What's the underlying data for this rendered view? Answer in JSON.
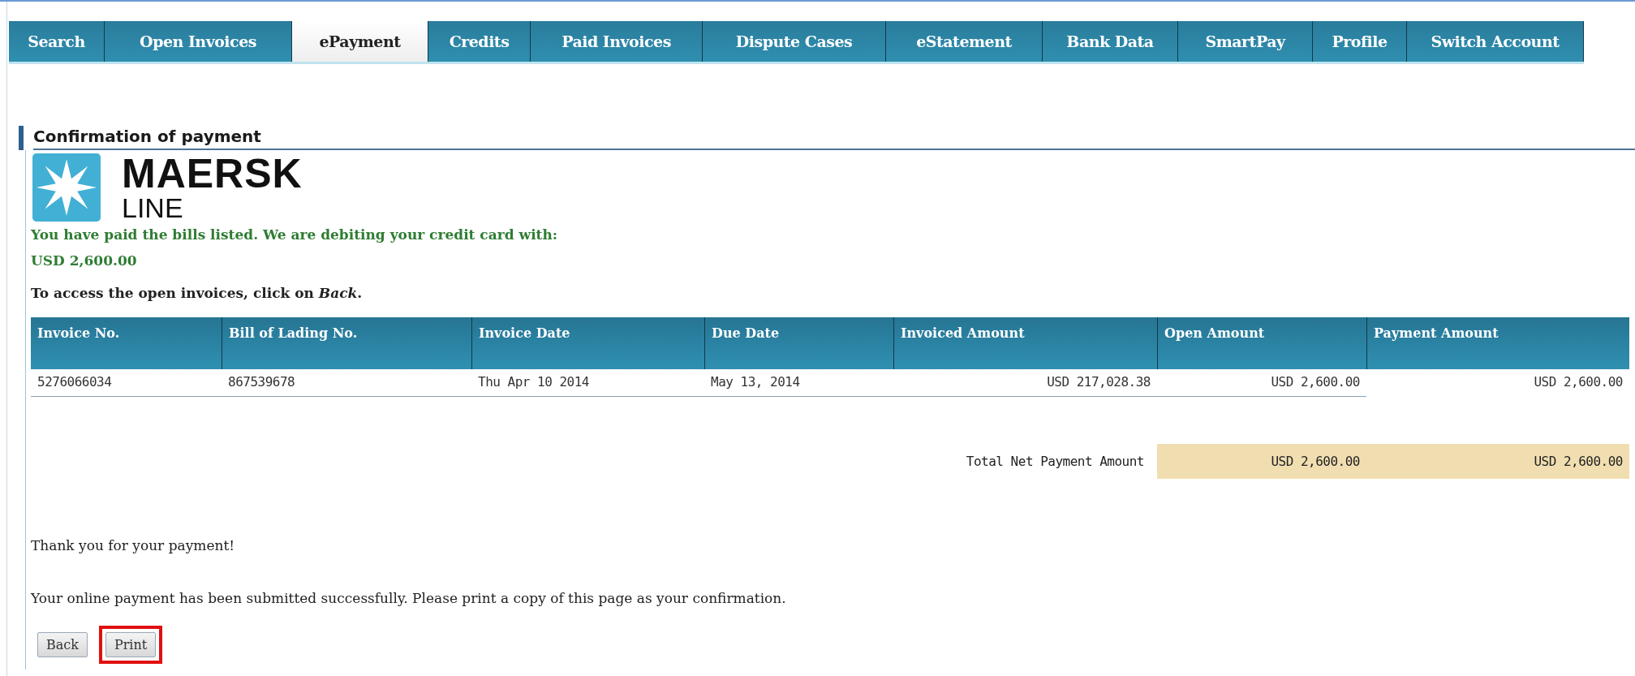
{
  "tabs": [
    {
      "label": "Search",
      "selected": false
    },
    {
      "label": "Open Invoices",
      "selected": false
    },
    {
      "label": "ePayment",
      "selected": true
    },
    {
      "label": "Credits",
      "selected": false
    },
    {
      "label": "Paid Invoices",
      "selected": false
    },
    {
      "label": "Dispute Cases",
      "selected": false
    },
    {
      "label": "eStatement",
      "selected": false
    },
    {
      "label": "Bank Data",
      "selected": false
    },
    {
      "label": "SmartPay",
      "selected": false
    },
    {
      "label": "Profile",
      "selected": false
    },
    {
      "label": "Switch Account",
      "selected": false
    }
  ],
  "section_title": "Confirmation of payment",
  "logo": {
    "name": "MAERSK",
    "subtitle": "LINE"
  },
  "success_message": "You have paid the bills listed. We are debiting your credit card with:",
  "debit_amount": "USD 2,600.00",
  "instruction": "To access the open invoices, click on *Back*.",
  "table": {
    "columns": [
      "Invoice No.",
      "Bill of Lading No.",
      "Invoice Date",
      "Due Date",
      "Invoiced Amount",
      "Open Amount",
      "Payment Amount"
    ],
    "rows": [
      [
        "5276066034",
        "867539678",
        "Thu Apr 10 2014",
        "May 13, 2014",
        "USD 217,028.38",
        "USD 2,600.00",
        "USD 2,600.00"
      ]
    ]
  },
  "total": {
    "label": "Total Net Payment Amount",
    "open_amount": "USD 2,600.00",
    "payment_amount": "USD 2,600.00"
  },
  "thanks": "Thank you for your payment!",
  "note": "Your online payment has been submitted successfully. Please print a copy of this page as your confirmation.",
  "buttons": [
    {
      "label": "Back",
      "highlighted": false
    },
    {
      "label": "Print",
      "highlighted": true
    }
  ]
}
